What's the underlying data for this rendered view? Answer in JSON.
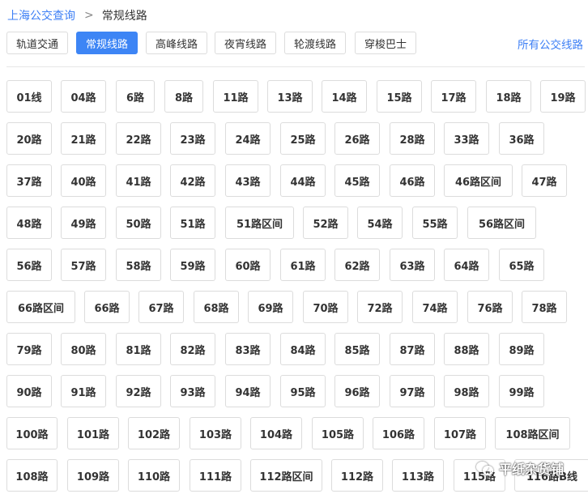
{
  "breadcrumb": {
    "root": "上海公交查询",
    "separator": ">",
    "current": "常规线路"
  },
  "tabs": [
    {
      "label": "轨道交通",
      "active": false
    },
    {
      "label": "常规线路",
      "active": true
    },
    {
      "label": "高峰线路",
      "active": false
    },
    {
      "label": "夜宵线路",
      "active": false
    },
    {
      "label": "轮渡线路",
      "active": false
    },
    {
      "label": "穿梭巴士",
      "active": false
    }
  ],
  "all_routes_link": "所有公交线路",
  "routes": [
    [
      "01线",
      "04路",
      "6路",
      "8路",
      "11路",
      "13路",
      "14路",
      "15路",
      "17路",
      "18路",
      "19路"
    ],
    [
      "20路",
      "21路",
      "22路",
      "23路",
      "24路",
      "25路",
      "26路",
      "28路",
      "33路",
      "36路"
    ],
    [
      "37路",
      "40路",
      "41路",
      "42路",
      "43路",
      "44路",
      "45路",
      "46路",
      "46路区间",
      "47路"
    ],
    [
      "48路",
      "49路",
      "50路",
      "51路",
      "51路区间",
      "52路",
      "54路",
      "55路",
      "56路区间"
    ],
    [
      "56路",
      "57路",
      "58路",
      "59路",
      "60路",
      "61路",
      "62路",
      "63路",
      "64路",
      "65路"
    ],
    [
      "66路区间",
      "66路",
      "67路",
      "68路",
      "69路",
      "70路",
      "72路",
      "74路",
      "76路",
      "78路"
    ],
    [
      "79路",
      "80路",
      "81路",
      "82路",
      "83路",
      "84路",
      "85路",
      "87路",
      "88路",
      "89路"
    ],
    [
      "90路",
      "91路",
      "92路",
      "93路",
      "94路",
      "95路",
      "96路",
      "97路",
      "98路",
      "99路"
    ],
    [
      "100路",
      "101路",
      "102路",
      "103路",
      "104路",
      "105路",
      "106路",
      "107路",
      "108路区间"
    ],
    [
      "108路",
      "109路",
      "110路",
      "111路",
      "112路区间",
      "112路",
      "113路",
      "115路",
      "116路B线"
    ]
  ],
  "watermark": "平纸杂货铺",
  "colors": {
    "accent": "#3d85f5",
    "link": "#3d7ff5",
    "border": "#dcdcdc",
    "text": "#333333"
  }
}
